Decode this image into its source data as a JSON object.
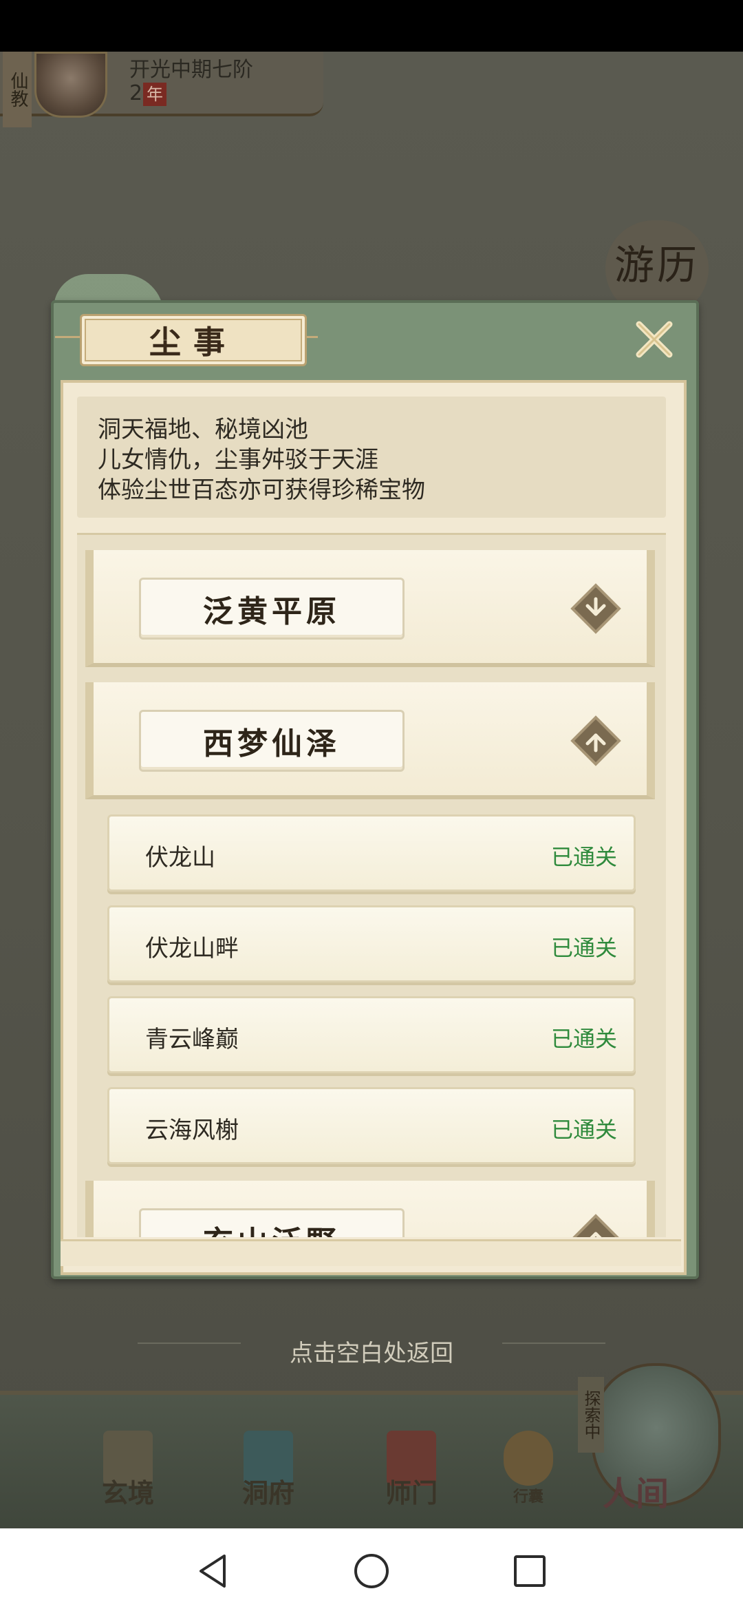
{
  "player": {
    "sect": "仙教",
    "cultivation_level": "开光中期七阶",
    "age_value": "2",
    "age_unit": "年"
  },
  "side_badge": "游历",
  "dialog": {
    "title": "尘事",
    "description_lines": [
      "洞天福地、秘境凶池",
      "儿女情仇，尘事舛驳于天涯",
      "体验尘世百态亦可获得珍稀宝物"
    ],
    "regions": [
      {
        "name": "泛黄平原",
        "expanded": false,
        "toggle_icon": "chevron-down-icon"
      },
      {
        "name": "西梦仙泽",
        "expanded": true,
        "toggle_icon": "chevron-up-icon"
      },
      {
        "name": "玄山泛野",
        "expanded": true,
        "toggle_icon": "chevron-up-icon"
      }
    ],
    "stages": [
      {
        "name": "伏龙山",
        "status": "已通关"
      },
      {
        "name": "伏龙山畔",
        "status": "已通关"
      },
      {
        "name": "青云峰巅",
        "status": "已通关"
      },
      {
        "name": "云海风榭",
        "status": "已通关"
      }
    ]
  },
  "return_hint": "点击空白处返回",
  "bottom_nav": {
    "items": [
      {
        "label": "玄境",
        "icon": "scroll-icon"
      },
      {
        "label": "洞府",
        "icon": "pavilion-icon"
      },
      {
        "label": "师门",
        "icon": "banner-icon"
      },
      {
        "label": "行囊",
        "icon": "bag-icon"
      }
    ],
    "exploring_tag": "探索中",
    "renjian_label": "人间"
  },
  "system_nav": {
    "back": "back-icon",
    "home": "home-icon",
    "recents": "recents-icon"
  },
  "colors": {
    "dialog_frame": "#7b9277",
    "cleared_status": "#2f8a3c",
    "title_text": "#3a2a1a"
  }
}
